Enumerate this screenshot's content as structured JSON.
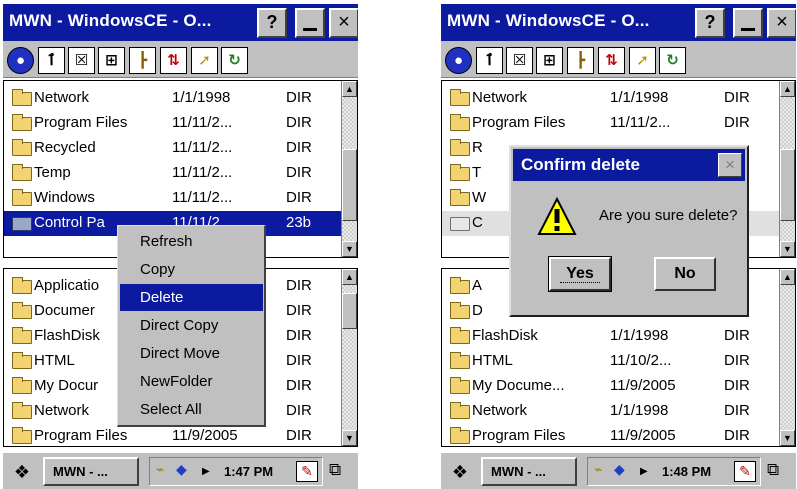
{
  "colors": {
    "titlebar": "#0b1a9e",
    "selection": "#0b1a9e",
    "chrome": "#c0c0c0",
    "folder": "#f3d271"
  },
  "left": {
    "title": "MWN - WindowsCE - O...",
    "help": "?",
    "close": "×",
    "toolbar": [
      "globe-icon",
      "search-icon",
      "select-box-icon",
      "tree-icon",
      "folder-up-icon",
      "sort-icon",
      "explore-icon",
      "refresh-icon"
    ],
    "top_pane": [
      {
        "name": "Network",
        "date": "1/1/1998",
        "type": "DIR"
      },
      {
        "name": "Program Files",
        "date": "11/11/2...",
        "type": "DIR"
      },
      {
        "name": "Recycled",
        "date": "11/11/2...",
        "type": "DIR"
      },
      {
        "name": "Temp",
        "date": "11/11/2...",
        "type": "DIR"
      },
      {
        "name": "Windows",
        "date": "11/11/2...",
        "type": "DIR"
      },
      {
        "name": "Control Pa",
        "date": "11/11/2...",
        "type": "23b"
      }
    ],
    "bottom_pane": [
      {
        "name": "Applicatio",
        "date": "",
        "type": "DIR"
      },
      {
        "name": "Documer",
        "date": "",
        "type": "DIR"
      },
      {
        "name": "FlashDisk",
        "date": "",
        "type": "DIR"
      },
      {
        "name": "HTML",
        "date": "",
        "type": "DIR"
      },
      {
        "name": "My Docur",
        "date": "",
        "type": "DIR"
      },
      {
        "name": "Network",
        "date": "",
        "type": "DIR"
      },
      {
        "name": "Program Files",
        "date": "11/9/2005",
        "type": "DIR"
      }
    ],
    "context_menu": [
      "Refresh",
      "Copy",
      "Delete",
      "Direct Copy",
      "Direct Move",
      "NewFolder",
      "Select All"
    ],
    "taskbar": {
      "task": "MWN - ...",
      "time": "1:47 PM"
    }
  },
  "right": {
    "title": "MWN - WindowsCE - O...",
    "help": "?",
    "close": "×",
    "top_pane": [
      {
        "name": "Network",
        "date": "1/1/1998",
        "type": "DIR"
      },
      {
        "name": "Program Files",
        "date": "11/11/2...",
        "type": "DIR"
      },
      {
        "name": "R",
        "date": "",
        "type": ""
      },
      {
        "name": "T",
        "date": "",
        "type": ""
      },
      {
        "name": "W",
        "date": "",
        "type": ""
      },
      {
        "name": "C",
        "date": "",
        "type": ""
      }
    ],
    "bottom_pane": [
      {
        "name": "A",
        "date": "",
        "type": ""
      },
      {
        "name": "D",
        "date": "",
        "type": ""
      },
      {
        "name": "FlashDisk",
        "date": "1/1/1998",
        "type": "DIR"
      },
      {
        "name": "HTML",
        "date": "11/10/2...",
        "type": "DIR"
      },
      {
        "name": "My Docume...",
        "date": "11/9/2005",
        "type": "DIR"
      },
      {
        "name": "Network",
        "date": "1/1/1998",
        "type": "DIR"
      },
      {
        "name": "Program Files",
        "date": "11/9/2005",
        "type": "DIR"
      }
    ],
    "dialog": {
      "title": "Confirm delete",
      "close": "×",
      "message": "Are you sure delete?",
      "yes": "Yes",
      "no": "No"
    },
    "taskbar": {
      "task": "MWN - ...",
      "time": "1:48 PM"
    }
  }
}
